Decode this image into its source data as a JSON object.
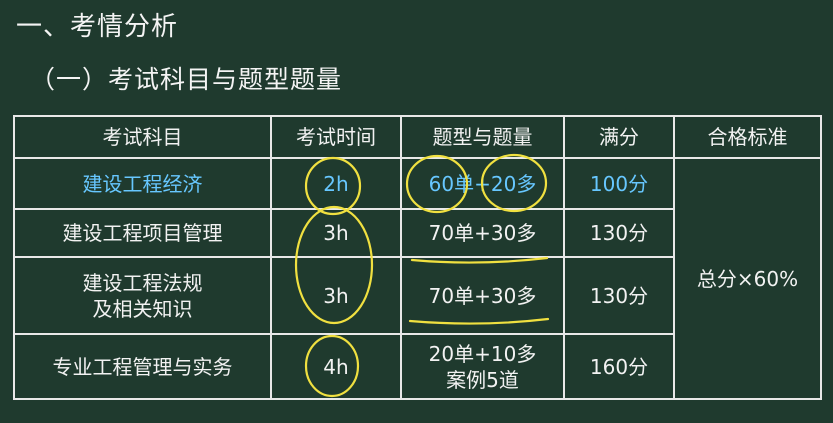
{
  "heading": "一、考情分析",
  "subheading": "（一）考试科目与题型题量",
  "table": {
    "headers": [
      "考试科目",
      "考试时间",
      "题型与题量",
      "满分",
      "合格标准"
    ],
    "rows": [
      {
        "subject": "建设工程经济",
        "time": "2h",
        "format": "60单+20多",
        "format2": "",
        "score": "100分"
      },
      {
        "subject": "建设工程项目管理",
        "time": "3h",
        "format": "70单+30多",
        "format2": "",
        "score": "130分"
      },
      {
        "subject": "建设工程法规",
        "subject2": "及相关知识",
        "time": "3h",
        "format": "70单+30多",
        "format2": "",
        "score": "130分"
      },
      {
        "subject": "专业工程管理与实务",
        "time": "4h",
        "format": "20单+10多",
        "format2": "案例5道",
        "score": "160分"
      }
    ],
    "pass_standard": "总分×60%"
  },
  "colors": {
    "background": "#1f3a2e",
    "highlight_text": "#67c7ff",
    "annotation": "#f0e040"
  }
}
